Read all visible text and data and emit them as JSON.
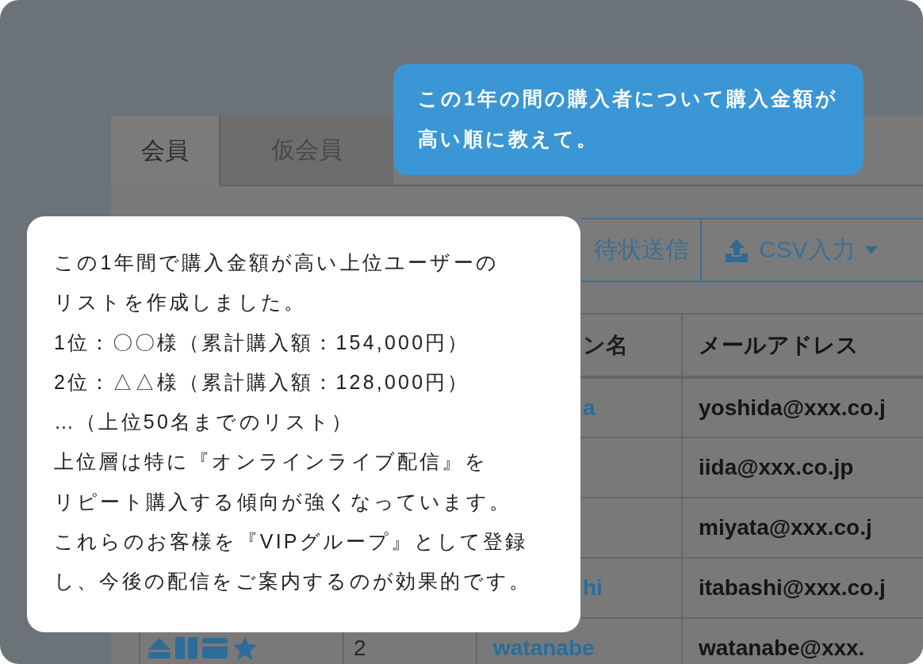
{
  "tabs": [
    {
      "label": "会員",
      "selected": true
    },
    {
      "label": "仮会員",
      "selected": false
    }
  ],
  "toolbar": {
    "buttons": [
      {
        "kind": "plain",
        "label": "待状送信"
      },
      {
        "kind": "upload-dropdown",
        "label": "CSV入力"
      }
    ]
  },
  "table": {
    "header": {
      "column_3": "ン名",
      "column_4": "メールアドレス"
    },
    "rows": [
      {
        "kind": "partial",
        "column_3": "a",
        "column_4": "yoshida@xxx.co.j"
      },
      {
        "kind": "partial",
        "column_4": "iida@xxx.co.jp"
      },
      {
        "kind": "partial",
        "column_4": "miyata@xxx.co.j"
      },
      {
        "kind": "partial",
        "column_3": "hi",
        "column_4": "itabashi@xxx.co.j"
      },
      {
        "kind": "full",
        "column_2": "2",
        "column_3": "watanabe",
        "column_4": "watanabe@xxx."
      }
    ]
  },
  "user_message": {
    "lines": [
      "この1年の間の購入者について購入金額が",
      "高い順に教えて。"
    ]
  },
  "assistant_message": {
    "lines": [
      "この1年間で購入金額が高い上位ユーザーの",
      "リストを作成しました。",
      "1位：〇〇様（累計購入額：154,000円）",
      "2位：△△様（累計購入額：128,000円）",
      "…（上位50名までのリスト）",
      "上位層は特に『オンラインライブ配信』を",
      "リピート購入する傾向が強くなっています。",
      "これらのお客様を『VIPグループ』として登録",
      "し、今後の配信をご案内するのが効果的です。"
    ]
  }
}
